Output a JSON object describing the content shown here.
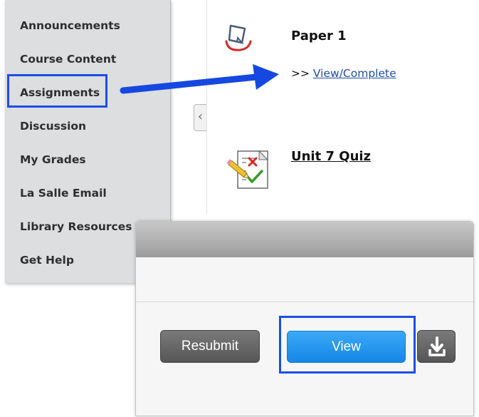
{
  "course_menu": {
    "items": [
      {
        "label": "Announcements"
      },
      {
        "label": "Course Content"
      },
      {
        "label": "Assignments"
      },
      {
        "label": "Discussion"
      },
      {
        "label": "My Grades"
      },
      {
        "label": "La Salle Email"
      },
      {
        "label": "Library Resources"
      },
      {
        "label": "Get Help"
      }
    ],
    "highlighted_item": "Assignments"
  },
  "content": {
    "items": [
      {
        "title": "Paper 1",
        "icon": "assignment-icon",
        "action_prefix": ">>",
        "action_link": "View/Complete"
      },
      {
        "title": "Unit 7 Quiz",
        "icon": "quiz-icon"
      }
    ]
  },
  "submission_panel": {
    "resubmit_label": "Resubmit",
    "view_label": "View",
    "download_icon": "download-icon",
    "highlighted_button": "View"
  },
  "colors": {
    "highlight": "#1b4fe8",
    "view_button": "#2196f3",
    "menu_background": "#dcdedf"
  }
}
